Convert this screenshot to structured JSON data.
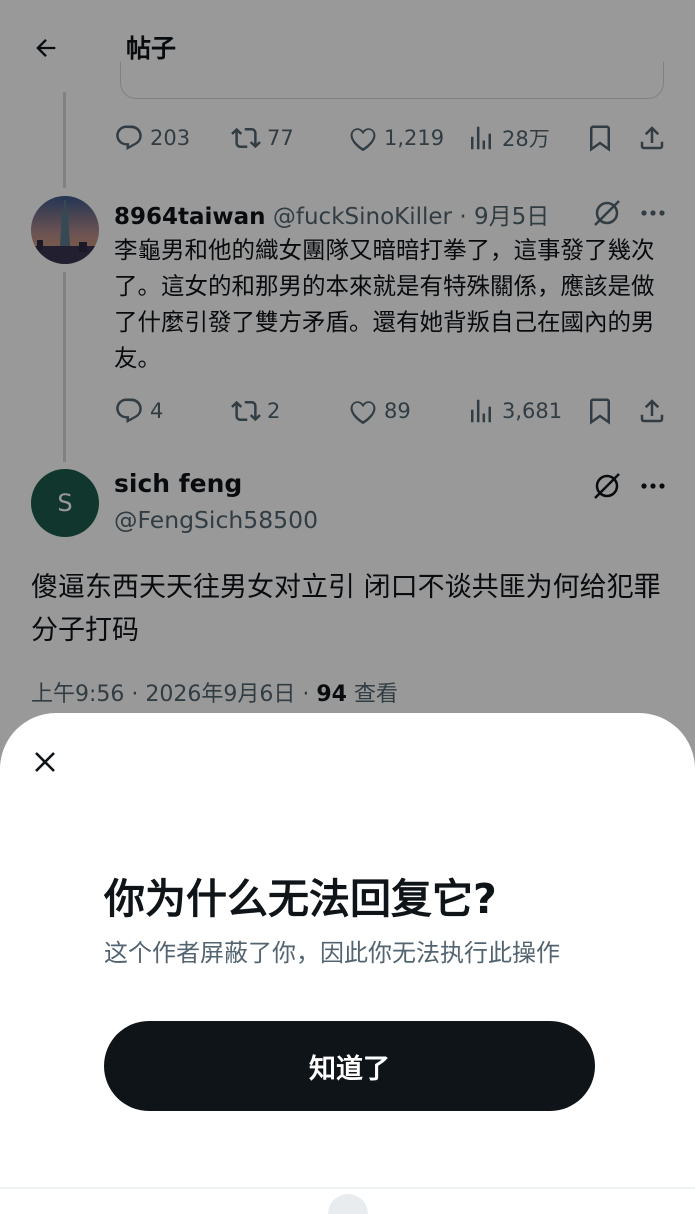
{
  "header": {
    "title": "帖子",
    "back_icon": "arrow-left-icon"
  },
  "top_actions": {
    "replies": "203",
    "retweets": "77",
    "likes": "1,219",
    "views": "28万"
  },
  "reply": {
    "name": "8964taiwan",
    "meta": "@fuckSinoKiller · 9月5日",
    "text": "李龜男和他的織女團隊又暗暗打拳了，這事發了幾次了。這女的和那男的本來就是有特殊關係，應該是做了什麼引發了雙方矛盾。還有她背叛自己在國內的男友。",
    "actions": {
      "replies": "4",
      "retweets": "2",
      "likes": "89",
      "views": "3,681"
    }
  },
  "main_post": {
    "avatar_letter": "S",
    "avatar_color": "#1c5a4b",
    "name": "sich feng",
    "handle": "@FengSich58500",
    "text": "傻逼东西天天往男女对立引 闭口不谈共匪为何给犯罪分子打码",
    "timestamp": "上午9:56 · 2026年9月6日 · ",
    "view_count": "94",
    "view_label": " 查看"
  },
  "sheet": {
    "title": "你为什么无法回复它?",
    "description": "这个作者屏蔽了你，因此你无法执行此操作",
    "button_label": "知道了"
  },
  "colors": {
    "overlay": "rgba(0,0,0,0.4)",
    "text": "#0f1419",
    "secondary": "#536471",
    "button": "#0f1419"
  }
}
